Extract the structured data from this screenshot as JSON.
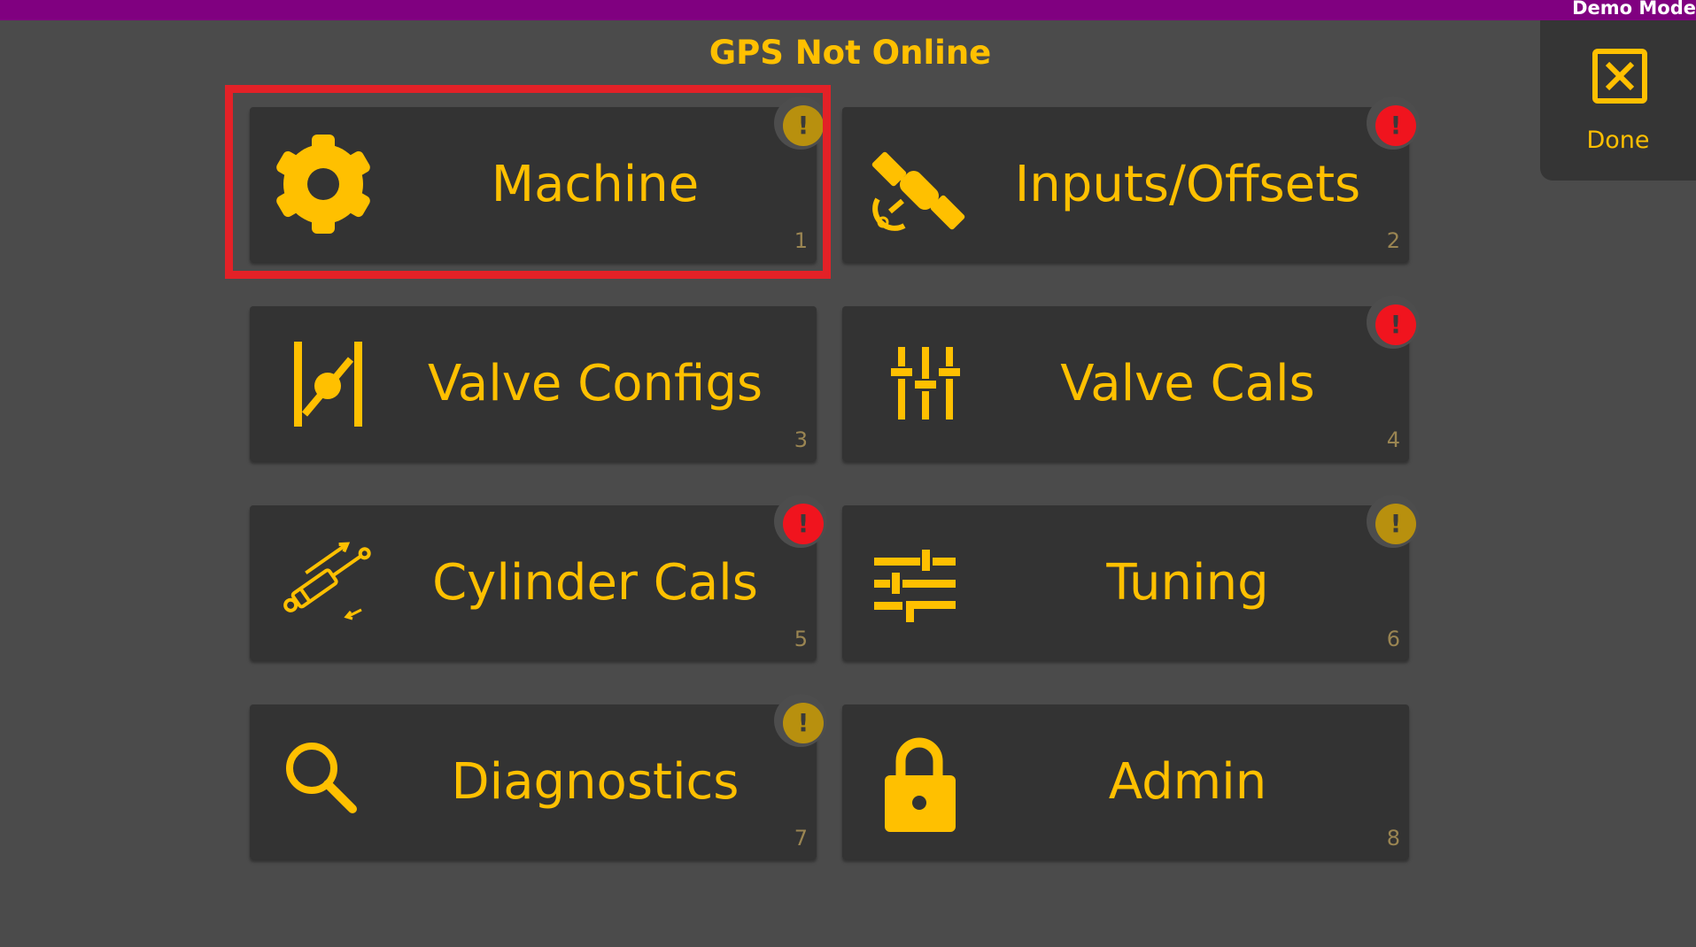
{
  "top_bar": {
    "demo_label": "Demo Mode",
    "color": "#800080"
  },
  "status_title": "GPS Not Online",
  "done": {
    "label": "Done",
    "icon": "close-box-icon"
  },
  "accent_color": "#ffc000",
  "badge_colors": {
    "warning": "#b8900e",
    "error": "#f0141e"
  },
  "badge_glyph": "!",
  "tiles": [
    {
      "label": "Machine",
      "number": "1",
      "icon": "gear-icon",
      "badge": "warning",
      "selected": true
    },
    {
      "label": "Inputs/Offsets",
      "number": "2",
      "icon": "satellite-icon",
      "badge": "error"
    },
    {
      "label": "Valve Configs",
      "number": "3",
      "icon": "valve-icon",
      "badge": ""
    },
    {
      "label": "Valve Cals",
      "number": "4",
      "icon": "vertical-sliders-icon",
      "badge": "error"
    },
    {
      "label": "Cylinder Cals",
      "number": "5",
      "icon": "cylinder-icon",
      "badge": "error"
    },
    {
      "label": "Tuning",
      "number": "6",
      "icon": "horizontal-sliders-icon",
      "badge": "warning"
    },
    {
      "label": "Diagnostics",
      "number": "7",
      "icon": "search-icon",
      "badge": "warning"
    },
    {
      "label": "Admin",
      "number": "8",
      "icon": "lock-icon",
      "badge": ""
    }
  ]
}
